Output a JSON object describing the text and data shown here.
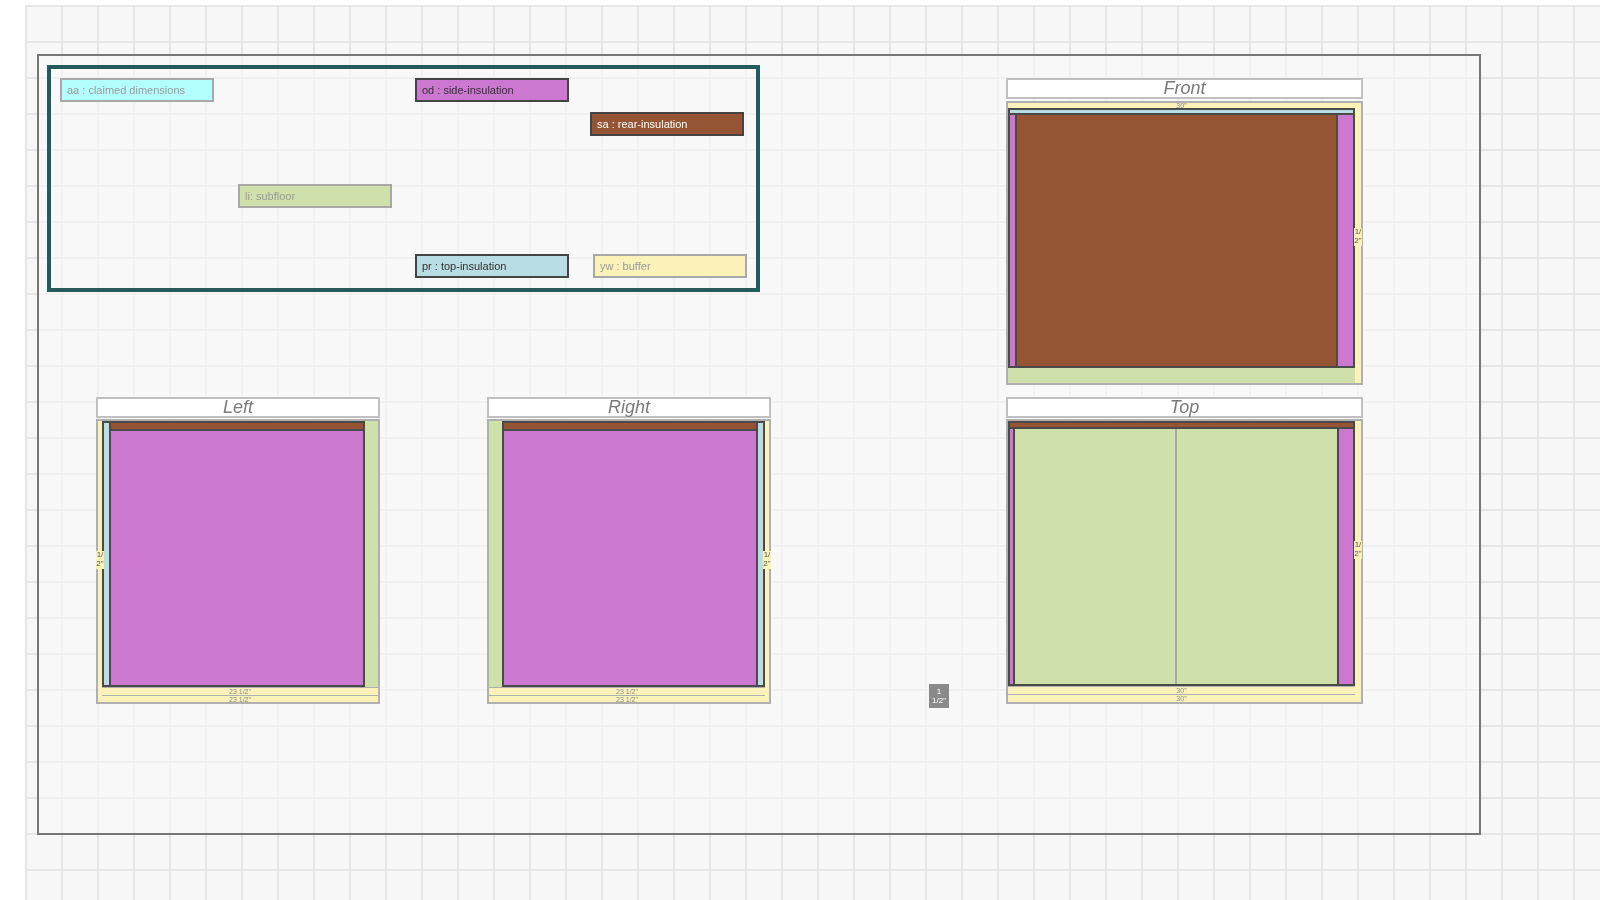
{
  "legend": [
    {
      "label": "aa : claimed dimensions",
      "color": "#b3ffff",
      "muted": true
    },
    {
      "label": "od : side-insulation",
      "color": "#cc77d0",
      "muted": false
    },
    {
      "label": "sa : rear-insulation",
      "color": "#955535",
      "muted": false
    },
    {
      "label": "li: subfloor",
      "color": "#d0e0aa",
      "muted": true
    },
    {
      "label": "pr : top-insulation",
      "color": "#b8dde3",
      "muted": false
    },
    {
      "label": "yw : buffer",
      "color": "#faf2b8",
      "muted": true
    }
  ],
  "views": [
    {
      "kind": "front",
      "title": "Front",
      "top_label": "30\"",
      "side_label": "1/2\""
    },
    {
      "kind": "left",
      "title": "Left",
      "bottom_labels": [
        "23 1/2\"",
        "23 1/2\""
      ],
      "side_label": "1/2\""
    },
    {
      "kind": "right",
      "title": "Right",
      "bottom_labels": [
        "23 1/2\"",
        "23 1/2\""
      ],
      "side_label": "1/2\""
    },
    {
      "kind": "top",
      "title": "Top",
      "bottom_labels": [
        "30\"",
        "30\""
      ],
      "side_label": "1/2\""
    }
  ],
  "marker": {
    "lines": [
      "1",
      "1/2\""
    ]
  }
}
